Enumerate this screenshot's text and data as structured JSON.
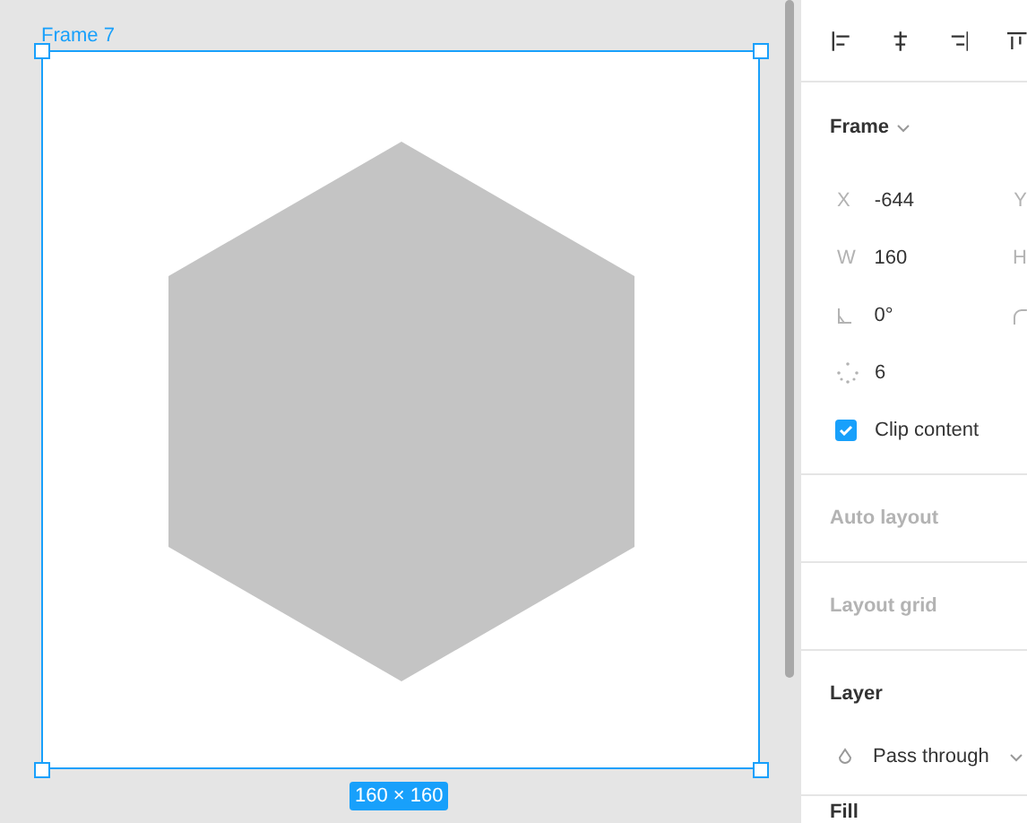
{
  "canvas": {
    "frame": {
      "name": "Frame 7",
      "size": "160 × 160",
      "selected": true
    }
  },
  "panel": {
    "frame_section": {
      "title": "Frame",
      "rows": [
        {
          "kind": "pair",
          "label": "X",
          "value": "-644",
          "side_label": "Y"
        },
        {
          "kind": "pair",
          "label": "W",
          "value": "160",
          "side_label": "H"
        },
        {
          "kind": "angle",
          "value": "0°"
        },
        {
          "kind": "points",
          "value": "6"
        }
      ],
      "clip_content": {
        "label": "Clip content",
        "checked": true
      }
    },
    "sections": [
      {
        "title": "Auto layout",
        "disabled": true
      },
      {
        "title": "Layout grid",
        "disabled": true
      }
    ],
    "layer": {
      "title": "Layer",
      "blend": "Pass through"
    },
    "fill": {
      "title": "Fill"
    }
  }
}
